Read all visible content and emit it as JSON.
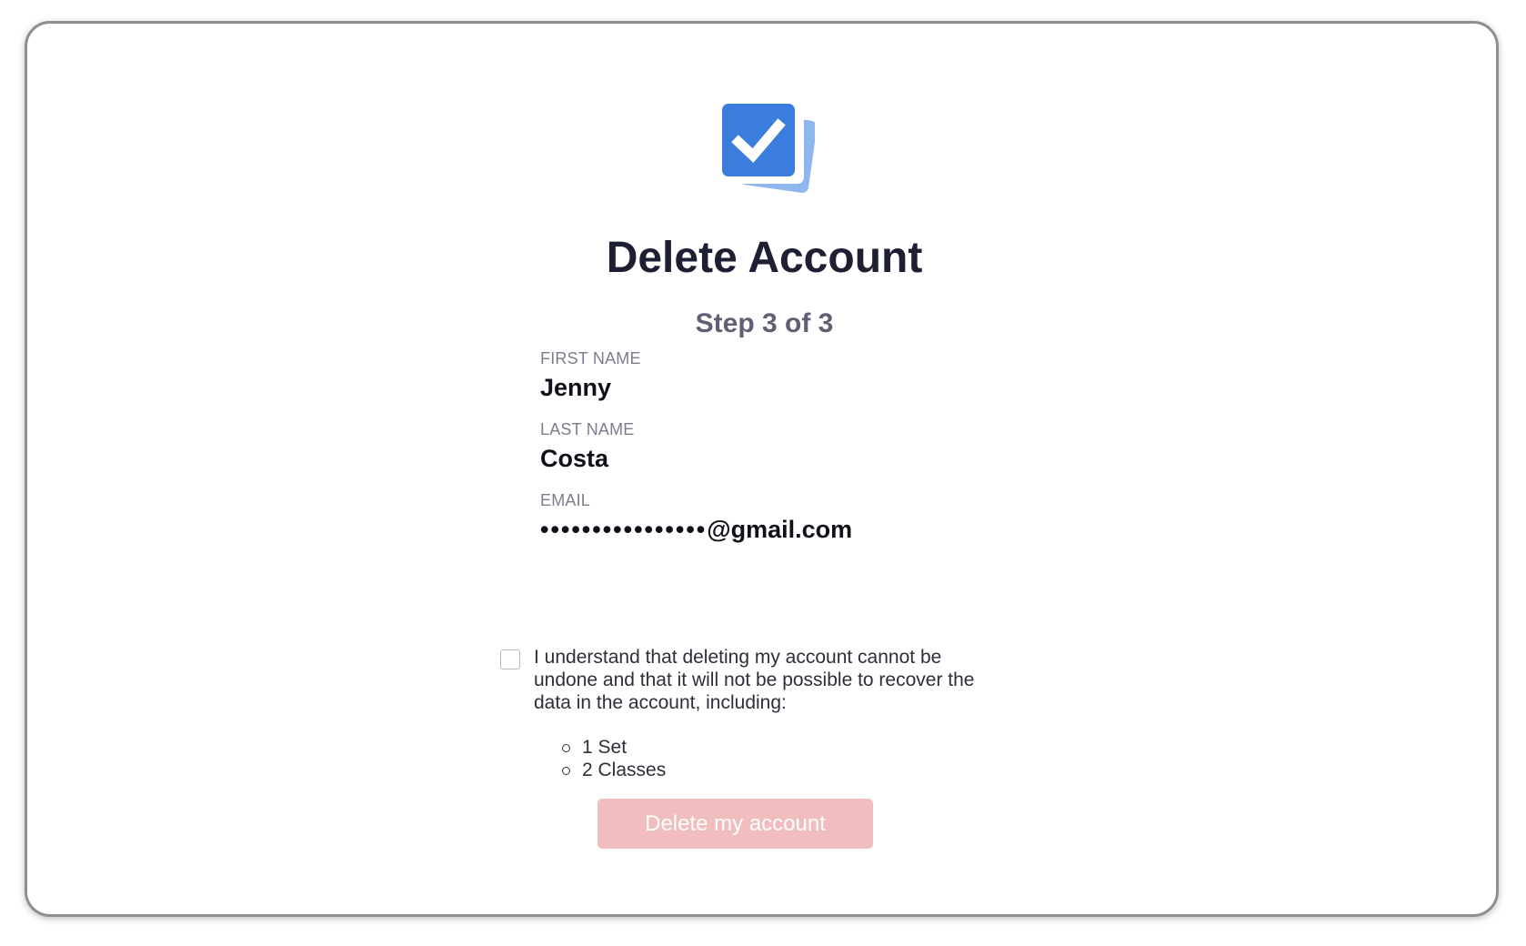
{
  "header": {
    "logo_icon": "stacked-checkbox-cards-icon",
    "title": "Delete Account",
    "step": "Step 3 of 3"
  },
  "fields": {
    "first_name": {
      "label": "FIRST NAME",
      "value": "Jenny"
    },
    "last_name": {
      "label": "LAST NAME",
      "value": "Costa"
    },
    "email": {
      "label": "EMAIL",
      "masked": "••••••••••••••••",
      "domain": "@gmail.com"
    }
  },
  "confirmation": {
    "checked": false,
    "text": "I understand that deleting my account cannot be undone and that it will not be possible to recover the data in the account, including:",
    "items": [
      "1 Set",
      "2 Classes"
    ]
  },
  "actions": {
    "delete_label": "Delete my account",
    "delete_enabled": false
  },
  "colors": {
    "brand_blue": "#3b7ddd",
    "brand_blue_light": "#8fb6ee",
    "title": "#1f1f33",
    "disabled_button": "#f2bdbe"
  }
}
